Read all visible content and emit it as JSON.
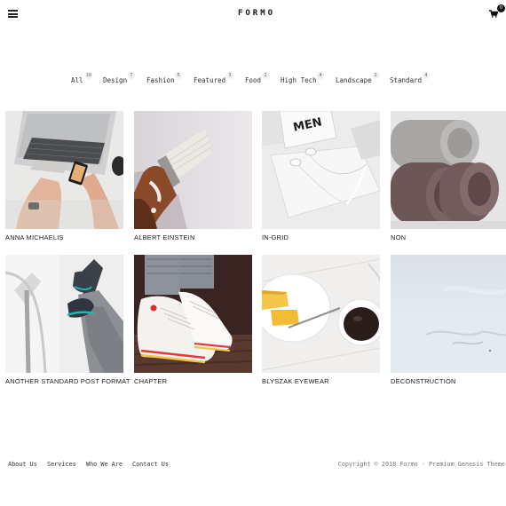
{
  "header": {
    "logo": "FORMO",
    "cart_count": "0",
    "icons": {
      "menu": "hamburger-menu-icon",
      "cart": "shopping-cart-icon"
    }
  },
  "filters": [
    {
      "label": "All",
      "count": "10"
    },
    {
      "label": "Design",
      "count": "7"
    },
    {
      "label": "Fashion",
      "count": "5"
    },
    {
      "label": "Featured",
      "count": "3"
    },
    {
      "label": "Food",
      "count": "2"
    },
    {
      "label": "High Tech",
      "count": "4"
    },
    {
      "label": "Landscape",
      "count": "2"
    },
    {
      "label": "Standard",
      "count": "4"
    }
  ],
  "posts": [
    {
      "title": "ANNA MICHAELIS",
      "image": "laptop-phone-photo"
    },
    {
      "title": "ALBERT EINSTEIN",
      "image": "paintbrush-photo"
    },
    {
      "title": "IN-GRID",
      "image": "earphones-notebook-photo"
    },
    {
      "title": "NON",
      "image": "folded-towels-photo"
    },
    {
      "title": "ANOTHER STANDARD POST FORMAT",
      "image": "sneakers-legs-photo"
    },
    {
      "title": "CHAPTER",
      "image": "white-sneakers-photo"
    },
    {
      "title": "BLYSZAK EYEWEAR",
      "image": "breakfast-coffee-photo"
    },
    {
      "title": "DECONSTRUCTION",
      "image": "snowy-landscape-photo"
    }
  ],
  "footer": {
    "links": [
      "About Us",
      "Services",
      "Who We Are",
      "Contact Us"
    ],
    "copyright": "Copyright © 2018 Formo · Premium Genesis Theme"
  }
}
